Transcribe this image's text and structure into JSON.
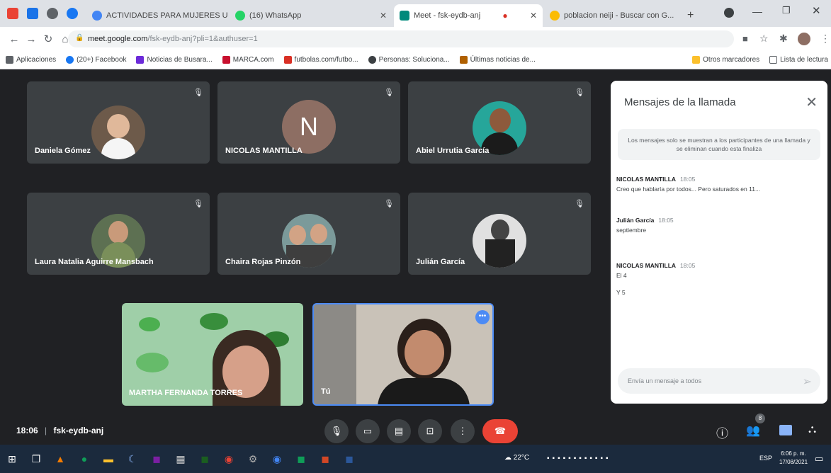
{
  "browser": {
    "tabs": [
      {
        "label": "ACTIVIDADES PARA MUJERES U",
        "color": "#4285f4"
      },
      {
        "label": "(16) WhatsApp",
        "color": "#25d366"
      },
      {
        "label": "Meet - fsk-eydb-anj",
        "color": "#00897b"
      },
      {
        "label": "poblacion neiji - Buscar con G...",
        "color": "#fbbc04"
      }
    ],
    "new_tab": "+",
    "url_host": "meet.google.com",
    "url_path": "/fsk-eydb-anj?pli=1&authuser=1",
    "bookmarks": [
      {
        "label": "Aplicaciones",
        "color": "#5f6368"
      },
      {
        "label": "(20+) Facebook",
        "color": "#1877f2"
      },
      {
        "label": "Noticias de Busara...",
        "color": "#6c2bd9"
      },
      {
        "label": "MARCA.com",
        "color": "#c8102e"
      },
      {
        "label": "futbolas.com/futbo...",
        "color": "#d93025"
      },
      {
        "label": "Personas: Soluciona...",
        "color": "#3c4043"
      },
      {
        "label": "Últimas noticias de...",
        "color": "#b06000"
      }
    ],
    "bookmarks_right": [
      "Otros marcadores",
      "Lista de lectura"
    ]
  },
  "meet": {
    "participants": [
      {
        "name": "Daniela Gómez",
        "kind": "photo",
        "bg": "#6d5a4a"
      },
      {
        "name": "NICOLAS MANTILLA",
        "kind": "initial",
        "initial": "N",
        "bg": "#8d6e63"
      },
      {
        "name": "Abiel Urrutia García",
        "kind": "photo",
        "bg": "#26a69a"
      },
      {
        "name": "Laura Natalia Aguirre Mansbach",
        "kind": "photo",
        "bg": "#5d7052"
      },
      {
        "name": "Chaira Rojas Pinzón",
        "kind": "photo",
        "bg": "#7b9a9a"
      },
      {
        "name": "Julián García",
        "kind": "photo",
        "bg": "#e0e0e0"
      }
    ],
    "videos": [
      {
        "name": "MARTHA FERNANDA TORRES",
        "bg": "#9fcfa8"
      },
      {
        "name": "Tú",
        "bg": "#c9c2b8"
      }
    ],
    "time": "18:06",
    "meeting_code": "fsk-eydb-anj",
    "people_count": "8"
  },
  "chat": {
    "title": "Mensajes de la llamada",
    "note": "Los mensajes solo se muestran a los participantes de una llamada y se eliminan cuando esta finaliza",
    "messages": [
      {
        "author": "NICOLAS MANTILLA",
        "time": "18:05",
        "lines": [
          "Creo que hablaría por todos... Pero saturados en 11..."
        ]
      },
      {
        "author": "Julián García",
        "time": "18:05",
        "lines": [
          "septiembre"
        ]
      },
      {
        "author": "NICOLAS MANTILLA",
        "time": "18:05",
        "lines": [
          "El 4",
          "Y 5"
        ]
      }
    ],
    "input_placeholder": "Envía un mensaje a todos"
  },
  "taskbar": {
    "temperature": "22°C",
    "lang": "ESP",
    "clock_time": "6:06 p. m.",
    "clock_date": "17/08/2021"
  }
}
